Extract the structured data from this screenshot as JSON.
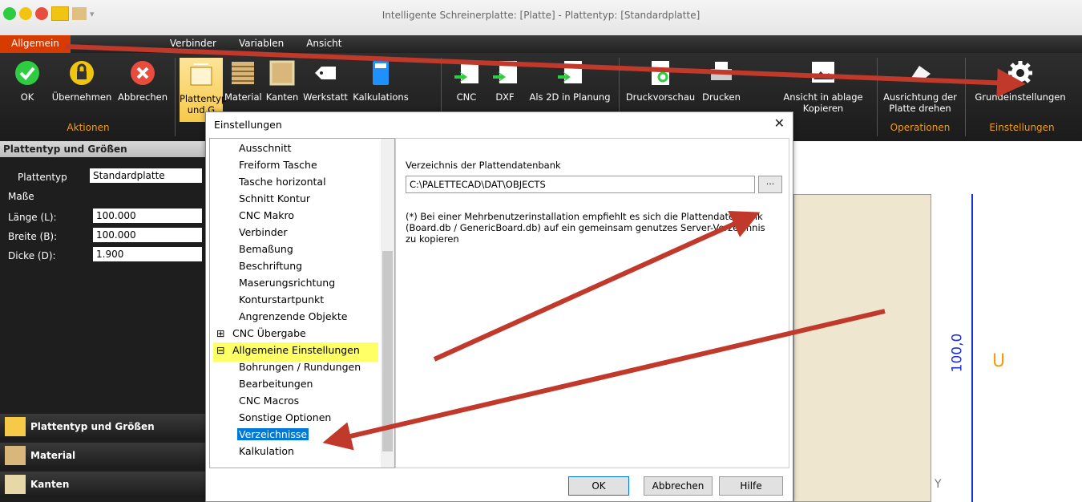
{
  "window": {
    "title": "Intelligente Schreinerplatte: [Platte] - Plattentyp: [Standardplatte]"
  },
  "tabs": [
    {
      "label": "Allgemein"
    },
    {
      "label": "Verbinder"
    },
    {
      "label": "Variablen"
    },
    {
      "label": "Ansicht"
    }
  ],
  "ribbon": {
    "buttons": [
      {
        "label": "OK",
        "icon": "check-icon"
      },
      {
        "label": "Übernehmen",
        "icon": "lock-icon"
      },
      {
        "label": "Abbrechen",
        "icon": "cancel-icon"
      },
      {
        "label": "Plattentyp und G",
        "icon": "plattentyp-icon"
      },
      {
        "label": "Material",
        "icon": "material-icon"
      },
      {
        "label": "Kanten",
        "icon": "kanten-icon"
      },
      {
        "label": "Werkstatt",
        "icon": "werkstatt-icon"
      },
      {
        "label": "Kalkulations",
        "icon": "calculator-icon"
      },
      {
        "label": "CNC",
        "icon": "cnc-icon"
      },
      {
        "label": "DXF",
        "icon": "dxf-icon"
      },
      {
        "label": "Als 2D in Planung",
        "icon": "p3d-icon"
      },
      {
        "label": "Druckvorschau",
        "icon": "print-preview-icon"
      },
      {
        "label": "Drucken",
        "icon": "printer-icon"
      },
      {
        "label": "Ansicht in ablage Kopieren",
        "icon": "image-icon"
      },
      {
        "label": "Ausrichtung der Platte drehen",
        "icon": "rotate-icon"
      },
      {
        "label": "Grundeinstellungen",
        "icon": "gear-icon"
      }
    ],
    "groups": {
      "aktionen": "Aktionen",
      "operationen": "Operationen",
      "einstellungen": "Einstellungen"
    }
  },
  "left": {
    "header": "Plattentyp und Größen",
    "plattentyp_label": "Plattentyp",
    "plattentyp_value": "Standardplatte",
    "masse_label": "Maße",
    "laenge_label": "Länge (L):",
    "laenge_value": "100.000",
    "breite_label": "Breite (B):",
    "breite_value": "100.000",
    "dicke_label": "Dicke (D):",
    "dicke_value": "1.900",
    "nav": [
      "Plattentyp und Größen",
      "Material",
      "Kanten"
    ]
  },
  "dialog": {
    "title": "Einstellungen",
    "tree": [
      "Ausschnitt",
      "Freiform Tasche",
      "Tasche horizontal",
      "Schnitt Kontur",
      "CNC Makro",
      "Verbinder",
      "Bemaßung",
      "Beschriftung",
      "Maserungsrichtung",
      "Konturstartpunkt",
      "Angrenzende Objekte",
      "CNC Übergabe",
      "Allgemeine Einstellungen",
      "Bohrungen / Rundungen",
      "Bearbeitungen",
      "CNC Macros",
      "Sonstige Optionen",
      "Verzeichnisse",
      "Kalkulation"
    ],
    "dir_label": "Verzeichnis der Plattendatenbank",
    "dir_value": "C:\\PALETTECAD\\DAT\\OBJECTS",
    "browse_label": "...",
    "hint": "(*) Bei einer Mehrbenutzerinstallation empfiehlt es sich die Plattendatenbank (Board.db / GenericBoard.db) auf ein gemeinsam genutzes Server-Verzeichnis zu kopieren",
    "ok": "OK",
    "cancel": "Abbrechen",
    "help": "Hilfe"
  },
  "canvas": {
    "dimension": "100,0",
    "letter": "U",
    "letter_y": "Y"
  },
  "colors": {
    "accent": "#d83b01",
    "arrow": "#c0392b",
    "plate": "#efe6cf",
    "dim": "#1a2fd6"
  }
}
